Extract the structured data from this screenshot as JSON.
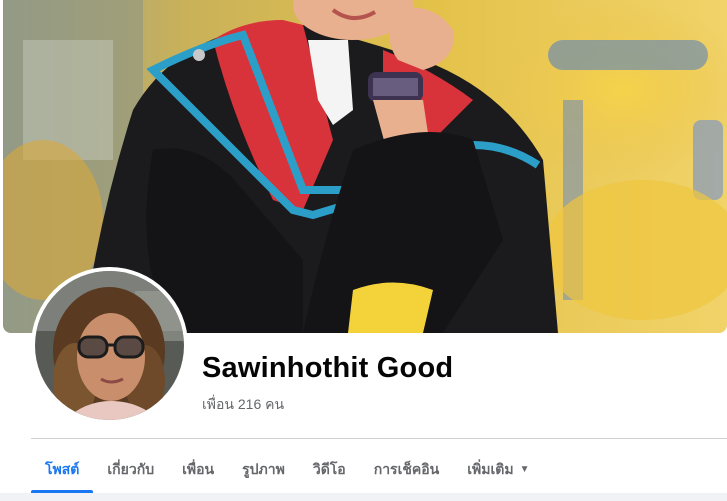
{
  "profile": {
    "name": "Sawinhothit Good",
    "friends": "เพื่อน 216 คน"
  },
  "tabs": [
    {
      "label": "โพสต์",
      "active": true
    },
    {
      "label": "เกี่ยวกับ",
      "active": false
    },
    {
      "label": "เพื่อน",
      "active": false
    },
    {
      "label": "รูปภาพ",
      "active": false
    },
    {
      "label": "วิดีโอ",
      "active": false
    },
    {
      "label": "การเช็คอิน",
      "active": false
    },
    {
      "label": "เพิ่มเติม",
      "active": false
    }
  ],
  "more_caret": "▼",
  "colors": {
    "accent": "#1877f2",
    "text": "#050505",
    "secondary": "#65676b"
  }
}
